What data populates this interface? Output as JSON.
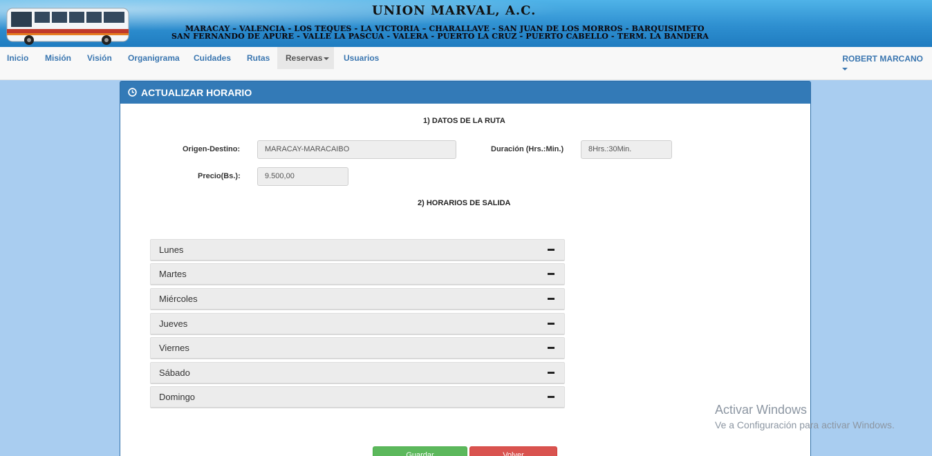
{
  "banner": {
    "title": "UNION MARVAL, A.C.",
    "routes_line1": "MARACAY – VALENCIA - LOS TEQUES - LA VICTORIA – CHARALLAVE - SAN JUAN DE LOS MORROS - BARQUISIMETO",
    "routes_line2": "SAN FERNANDO DE APURE - VALLE  LA PASCUA - VALERA - PUERTO LA CRUZ - PUERTO CABELLO - TERM. LA BANDERA"
  },
  "nav": {
    "items": [
      {
        "label": "Inicio"
      },
      {
        "label": "Misión"
      },
      {
        "label": "Visión"
      },
      {
        "label": "Organigrama"
      },
      {
        "label": "Cuidades"
      },
      {
        "label": "Rutas"
      },
      {
        "label": "Reservas"
      },
      {
        "label": "Usuarios"
      }
    ],
    "active": "Reservas",
    "user": "ROBERT MARCANO"
  },
  "panel": {
    "title": "ACTUALIZAR HORARIO",
    "section1": "1) DATOS DE LA RUTA",
    "section2": "2) HORARIOS DE SALIDA",
    "origin_label": "Origen-Destino:",
    "origin_value": "MARACAY-MARACAIBO",
    "duration_label": "Duración (Hrs.:Min.)",
    "duration_value": "8Hrs.:30Min.",
    "price_label": "Precio(Bs.):",
    "price_value": "9.500,00",
    "days": [
      {
        "label": "Lunes"
      },
      {
        "label": "Martes"
      },
      {
        "label": "Miércoles"
      },
      {
        "label": "Jueves"
      },
      {
        "label": "Viernes"
      },
      {
        "label": "Sábado"
      },
      {
        "label": "Domingo"
      }
    ],
    "save_label": "Guardar",
    "back_label": "Volver"
  },
  "watermark": {
    "line1": "Activar Windows",
    "line2": "Ve a Configuración para activar Windows."
  },
  "colors": {
    "primary": "#337ab7",
    "success": "#5cb85c",
    "danger": "#d9534f",
    "page_bg": "#a9cdf0"
  }
}
